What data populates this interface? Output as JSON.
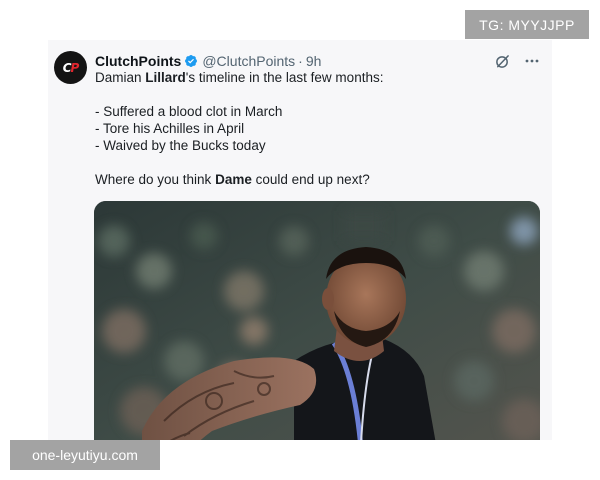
{
  "tweet": {
    "display_name": "ClutchPoints",
    "handle": "@ClutchPoints",
    "separator": "·",
    "time": "9h",
    "verified": true,
    "avatar_logo": {
      "left": "C",
      "right": "P"
    },
    "text": {
      "line1_pre": "Damian ",
      "line1_bold": "Lillard",
      "line1_post": "'s timeline in the last few months:",
      "bullet1": "- Suffered a blood clot in March",
      "bullet2": "- Tore his Achilles in April",
      "bullet3": "- Waived by the Bucks today",
      "question_pre": "Where do you think ",
      "question_bold": "Dame",
      "question_post": " could end up next?"
    },
    "media": {
      "subject": "basketball player in black jersey, tattooed arm, blurred crowd background",
      "jersey_color": "#14161a",
      "jersey_trim": "#6b7fd6",
      "crowd_tones": [
        "#2f3e3a",
        "#4b5a52",
        "#6f7b70",
        "#8a6f66"
      ]
    }
  },
  "icons": {
    "verified": "verified-badge-icon",
    "grok": "grok-icon",
    "more": "more-options-icon"
  },
  "colors": {
    "verified": "#1d9bf0",
    "secondary_text": "#536471",
    "watermark_bg": "#a3a3a3"
  },
  "watermarks": {
    "top": "TG: MYYJJPP",
    "bottom": "one-leyutiyu.com"
  }
}
